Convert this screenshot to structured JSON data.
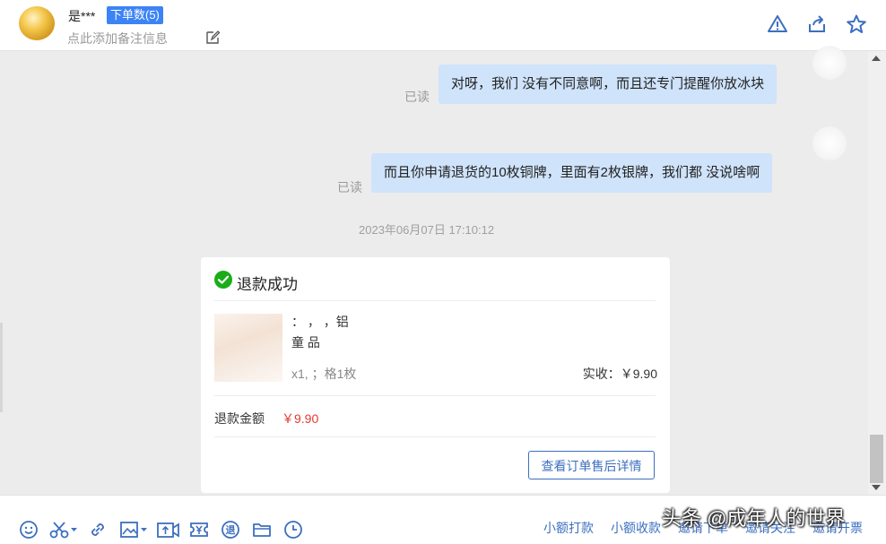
{
  "header": {
    "name": "是***",
    "order_badge": "下单数(5)",
    "note_placeholder": "点此添加备注信息"
  },
  "messages": [
    {
      "text": "对呀，我们 没有不同意啊，而且还专门提醒你放冰块",
      "status": "已读"
    },
    {
      "text": "而且你申请退货的10枚铜牌，里面有2枚银牌，我们都 没说啥啊",
      "status": "已读"
    }
  ],
  "timestamp": "2023年06月07日 17:10:12",
  "refund_card": {
    "title": "退款成功",
    "product_line1": "：      ，   ，铝",
    "product_line2": "童 品",
    "spec": "x1,      ；格1枚",
    "paid_label": "实收：",
    "paid_amount": "￥9.90",
    "refund_label": "退款金额",
    "refund_amount": "￥9.90",
    "detail_button": "查看订单售后详情"
  },
  "toolbar": {
    "links": [
      "小额打款",
      "小额收款",
      "邀请下单",
      "邀请关注",
      "邀请开票"
    ]
  },
  "watermark": "头条 @成年人的世界",
  "colors": {
    "accent": "#3c83f6",
    "bubble": "#cfe3fb",
    "link": "#3c6fbf",
    "price": "#e53935",
    "success": "#1aad19"
  }
}
